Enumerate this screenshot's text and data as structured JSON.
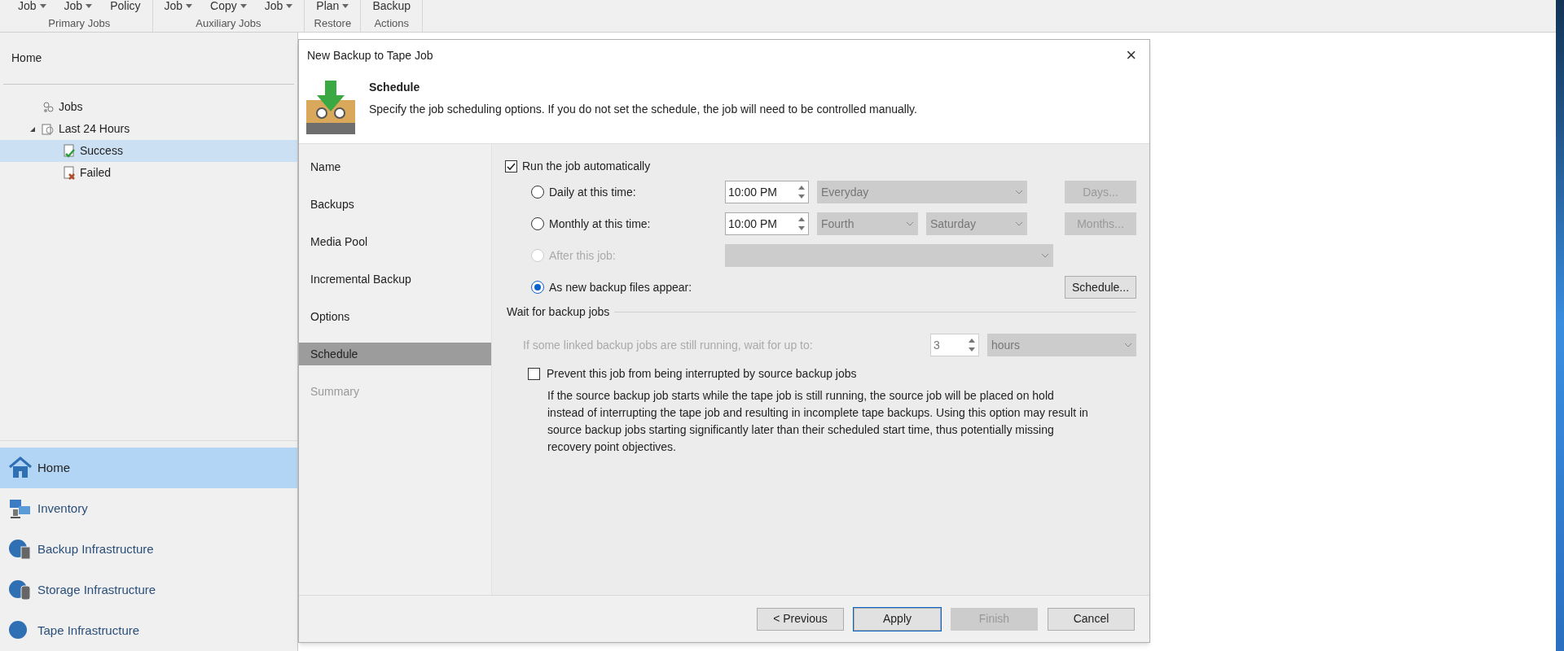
{
  "ribbon": {
    "groups": [
      {
        "label": "Primary Jobs",
        "buttons": [
          {
            "label": "Job",
            "dropdown": true
          },
          {
            "label": "Job",
            "dropdown": true
          },
          {
            "label": "Policy",
            "dropdown": false
          }
        ]
      },
      {
        "label": "Auxiliary Jobs",
        "buttons": [
          {
            "label": "Job",
            "dropdown": true
          },
          {
            "label": "Copy",
            "dropdown": true
          },
          {
            "label": "Job",
            "dropdown": true
          }
        ]
      },
      {
        "label": "Restore",
        "buttons": [
          {
            "label": "Plan",
            "dropdown": true
          }
        ]
      },
      {
        "label": "Actions",
        "buttons": [
          {
            "label": "Backup",
            "dropdown": false
          }
        ]
      }
    ]
  },
  "sidebar": {
    "title": "Home",
    "tree": [
      {
        "label": "Jobs",
        "kind": "jobs",
        "selected": false
      },
      {
        "label": "Last 24 Hours",
        "kind": "history",
        "selected": false,
        "expanded": true,
        "children": [
          {
            "label": "Success",
            "kind": "success",
            "selected": true
          },
          {
            "label": "Failed",
            "kind": "failed",
            "selected": false
          }
        ]
      }
    ],
    "nav": [
      {
        "label": "Home",
        "kind": "home",
        "selected": true
      },
      {
        "label": "Inventory",
        "kind": "inventory",
        "selected": false
      },
      {
        "label": "Backup Infrastructure",
        "kind": "backup",
        "selected": false
      },
      {
        "label": "Storage Infrastructure",
        "kind": "storage",
        "selected": false
      },
      {
        "label": "Tape Infrastructure",
        "kind": "tape",
        "selected": false
      }
    ]
  },
  "dialog": {
    "title": "New Backup to Tape Job",
    "close": "×",
    "header": {
      "title": "Schedule",
      "description": "Specify the job scheduling options. If you do not set the schedule, the job will need to be controlled manually."
    },
    "steps": [
      {
        "label": "Name",
        "selected": false,
        "disabled": false
      },
      {
        "label": "Backups",
        "selected": false,
        "disabled": false
      },
      {
        "label": "Media Pool",
        "selected": false,
        "disabled": false
      },
      {
        "label": "Incremental Backup",
        "selected": false,
        "disabled": false
      },
      {
        "label": "Options",
        "selected": false,
        "disabled": false
      },
      {
        "label": "Schedule",
        "selected": true,
        "disabled": false
      },
      {
        "label": "Summary",
        "selected": false,
        "disabled": true
      }
    ],
    "run_automatically": {
      "label": "Run the job automatically",
      "checked": true
    },
    "schedule_options": [
      {
        "label": "Daily at this time:",
        "kind": "time",
        "selected": false,
        "disabled": false,
        "time": "10:00 PM",
        "dropdowns": [
          "Everyday"
        ],
        "button": {
          "label": "Days...",
          "disabled": true
        }
      },
      {
        "label": "Monthly at this time:",
        "kind": "time",
        "selected": false,
        "disabled": false,
        "time": "10:00 PM",
        "dropdowns": [
          "Fourth",
          "Saturday"
        ],
        "button": {
          "label": "Months...",
          "disabled": true
        }
      },
      {
        "label": "After this job:",
        "kind": "job",
        "selected": false,
        "disabled": true
      },
      {
        "label": "As new backup files appear:",
        "kind": "event",
        "selected": true,
        "disabled": false,
        "button": {
          "label": "Schedule...",
          "disabled": false
        }
      }
    ],
    "wait": {
      "title": "Wait for backup jobs",
      "label": "If some linked backup jobs are still running, wait for up to:",
      "disabled": true,
      "value": "3",
      "unit": "hours"
    },
    "prevent": {
      "label": "Prevent this job from being interrupted by source backup jobs",
      "checked": false,
      "note": "If the source backup job starts while the tape job is still running, the source job will be placed on hold instead of interrupting the tape job and resulting in incomplete tape backups. Using this option may result in source backup jobs starting significantly later than their scheduled start time, thus potentially missing recovery point objectives."
    },
    "buttons": [
      {
        "label": "< Previous",
        "disabled": false,
        "default": false
      },
      {
        "label": "Apply",
        "disabled": false,
        "default": true
      },
      {
        "label": "Finish",
        "disabled": true,
        "default": false
      },
      {
        "label": "Cancel",
        "disabled": false,
        "default": false
      }
    ]
  }
}
